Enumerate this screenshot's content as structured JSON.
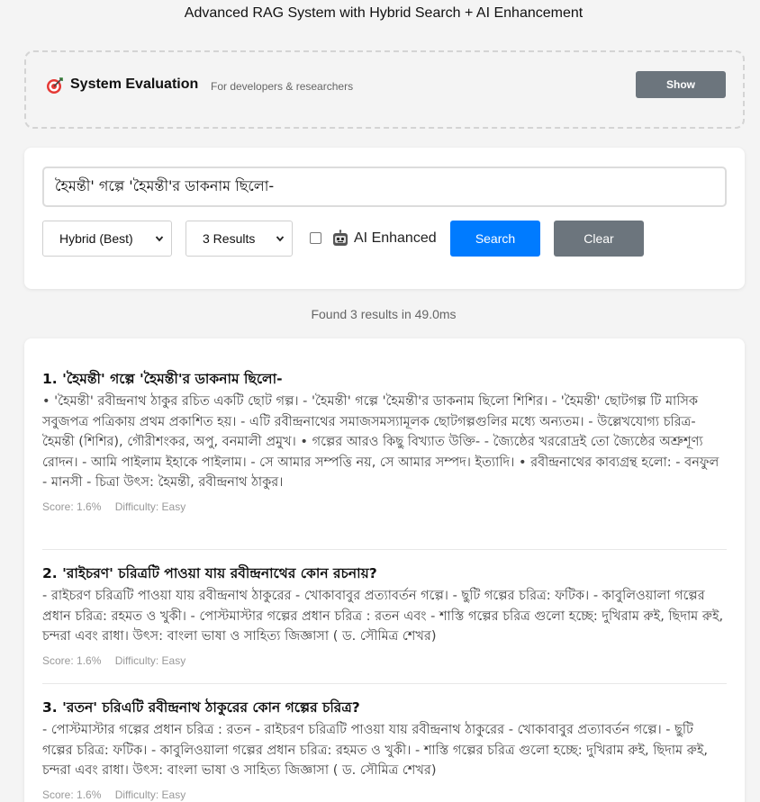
{
  "app": {
    "title": "Advanced RAG System with Hybrid Search + AI Enhancement"
  },
  "evaluation": {
    "icon": "dart-target-icon",
    "title": "System Evaluation",
    "subtitle": "For developers & researchers",
    "show_label": "Show"
  },
  "search": {
    "query": "হৈমন্তী' গল্পে 'হৈমন্তী'র ডাকনাম ছিলো-",
    "mode_selected": "Hybrid (Best)",
    "count_selected": "3 Results",
    "ai_checked": false,
    "ai_icon": "robot-icon",
    "ai_label": "AI Enhanced",
    "search_label": "Search",
    "clear_label": "Clear",
    "accent_color": "#007bff",
    "secondary_color": "#6c757d"
  },
  "summary": "Found 3 results in 49.0ms",
  "results": [
    {
      "title": "1. 'হৈমন্তী' গল্পে 'হৈমন্তী'র ডাকনাম ছিলো-",
      "body": "• 'হৈমন্তী' রবীন্দ্রনাথ ঠাকুর রচিত একটি ছোট গল্প। - 'হৈমন্তী' গল্পে 'হৈমন্তী'র ডাকনাম ছিলো শিশির। - 'হৈমন্তী' ছোটগল্প টি মাসিক সবুজপত্র পত্রিকায় প্রথম প্রকাশিত হয়। - এটি রবীন্দ্রনাথের সমাজসমস্যামূলক ছোটগল্পগুলির মধ্যে অন্যতম। - উল্লেখযোগ্য চরিত্র- হৈমন্তী (শিশির), গৌরীশংকর, অপু, বনমালী প্রমুখ। • গল্পের আরও কিছু বিখ্যাত উক্তি- - জ্যৈষ্ঠের খররোদ্রই তো জ্যৈষ্ঠের অশ্রুশূণ্য রোদন। - আমি পাইলাম ইহাকে পাইলাম। - সে আমার সম্পত্তি নয়, সে আমার সম্পদ। ইত্যাদি। • রবীন্দ্রনাথের কাব্যগ্রন্থ হলো: - বনফুল - মানসী - চিত্রা উৎস: হৈমন্তী, রবীন্দ্রনাথ ঠাকুর।",
      "score": "Score: 1.6%",
      "difficulty": "Difficulty: Easy"
    },
    {
      "title": "2. 'রাইচরণ' চরিত্রটি পাওয়া যায় রবীন্দ্রনাথের কোন রচনায়?",
      "body": "- রাইচরণ চরিত্রটি পাওয়া যায় রবীন্দ্রনাথ ঠাকুরের - খোকাবাবুর প্রত্যাবর্তন গল্পে। - ছুটি গল্পের চরিত্র: ফটিক। - কাবুলিওয়ালা গল্পের প্রধান চরিত্র: রহমত ও খুকী। - পোস্টমাস্টার গল্পের প্রধান চরিত্র : রতন এবং - শাস্তি গল্পের চরিত্র গুলো হচ্ছে: দুখিরাম রুই, ছিদাম রুই, চন্দরা এবং রাধা। উৎস: বাংলা ভাষা ও সাহিত্য জিজ্ঞাসা ( ড. সৌমিত্র শেখর)",
      "score": "Score: 1.6%",
      "difficulty": "Difficulty: Easy"
    },
    {
      "title": "3. 'রতন' চরিএটি রবীন্দ্রনাথ ঠাকুরের কোন গল্পের চরিত্র?",
      "body": "- পোস্টমাস্টার গল্পের প্রধান চরিত্র : রতন - রাইচরণ চরিত্রটি পাওয়া যায় রবীন্দ্রনাথ ঠাকুরের - খোকাবাবুর প্রত্যাবর্তন গল্পে। - ছুটি গল্পের চরিত্র: ফটিক। - কাবুলিওয়ালা গল্পের প্রধান চরিত্র: রহমত ও খুকী। - শাস্তি গল্পের চরিত্র গুলো হচ্ছে: দুখিরাম রুই, ছিদাম রুই, চন্দরা এবং রাধা। উৎস: বাংলা ভাষা ও সাহিত্য জিজ্ঞাসা ( ড. সৌমিত্র শেখর)",
      "score": "Score: 1.6%",
      "difficulty": "Difficulty: Easy"
    }
  ]
}
